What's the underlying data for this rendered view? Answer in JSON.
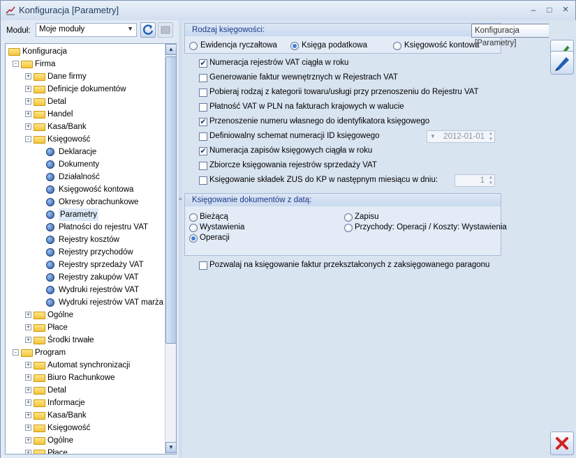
{
  "window": {
    "title": "Konfiguracja [Parametry]",
    "minimize": "–",
    "maximize": "□",
    "close": "×"
  },
  "module": {
    "label": "Moduł:",
    "value": "Moje moduły"
  },
  "tree": {
    "items": [
      {
        "label": "Konfiguracja",
        "level": 0,
        "icon": "folder-open-icon"
      },
      {
        "label": "Firma",
        "level": 1,
        "icon": "folder-open-icon",
        "expander": "-"
      },
      {
        "label": "Dane firmy",
        "level": 2,
        "icon": "folder-icon",
        "expander": "+"
      },
      {
        "label": "Definicje dokumentów",
        "level": 2,
        "icon": "folder-icon",
        "expander": "+"
      },
      {
        "label": "Detal",
        "level": 2,
        "icon": "folder-icon",
        "expander": "+"
      },
      {
        "label": "Handel",
        "level": 2,
        "icon": "folder-icon",
        "expander": "+"
      },
      {
        "label": "Kasa/Bank",
        "level": 2,
        "icon": "folder-icon",
        "expander": "+"
      },
      {
        "label": "Księgowość",
        "level": 2,
        "icon": "folder-open-icon",
        "expander": "-"
      },
      {
        "label": "Deklaracje",
        "level": 3,
        "icon": "leaf-icon"
      },
      {
        "label": "Dokumenty",
        "level": 3,
        "icon": "leaf-icon"
      },
      {
        "label": "Działalność",
        "level": 3,
        "icon": "leaf-icon"
      },
      {
        "label": "Księgowość kontowa",
        "level": 3,
        "icon": "leaf-icon"
      },
      {
        "label": "Okresy obrachunkowe",
        "level": 3,
        "icon": "leaf-icon"
      },
      {
        "label": "Parametry",
        "level": 3,
        "icon": "leaf-icon",
        "selected": true
      },
      {
        "label": "Płatności do rejestru VAT",
        "level": 3,
        "icon": "leaf-icon"
      },
      {
        "label": "Rejestry kosztów",
        "level": 3,
        "icon": "leaf-icon"
      },
      {
        "label": "Rejestry przychodów",
        "level": 3,
        "icon": "leaf-icon"
      },
      {
        "label": "Rejestry sprzedaży VAT",
        "level": 3,
        "icon": "leaf-icon"
      },
      {
        "label": "Rejestry zakupów VAT",
        "level": 3,
        "icon": "leaf-icon"
      },
      {
        "label": "Wydruki rejestrów VAT",
        "level": 3,
        "icon": "leaf-icon"
      },
      {
        "label": "Wydruki rejestrów VAT marża",
        "level": 3,
        "icon": "leaf-icon"
      },
      {
        "label": "Ogólne",
        "level": 2,
        "icon": "folder-icon",
        "expander": "+"
      },
      {
        "label": "Płace",
        "level": 2,
        "icon": "folder-icon",
        "expander": "+"
      },
      {
        "label": "Środki trwałe",
        "level": 2,
        "icon": "folder-icon",
        "expander": "+"
      },
      {
        "label": "Program",
        "level": 1,
        "icon": "folder-open-icon",
        "expander": "-"
      },
      {
        "label": "Automat synchronizacji",
        "level": 2,
        "icon": "folder-icon",
        "expander": "+"
      },
      {
        "label": "Biuro Rachunkowe",
        "level": 2,
        "icon": "folder-icon",
        "expander": "+"
      },
      {
        "label": "Detal",
        "level": 2,
        "icon": "folder-icon",
        "expander": "+"
      },
      {
        "label": "Informacje",
        "level": 2,
        "icon": "folder-icon",
        "expander": "+"
      },
      {
        "label": "Kasa/Bank",
        "level": 2,
        "icon": "folder-icon",
        "expander": "+"
      },
      {
        "label": "Księgowość",
        "level": 2,
        "icon": "folder-icon",
        "expander": "+"
      },
      {
        "label": "Ogólne",
        "level": 2,
        "icon": "folder-icon",
        "expander": "+"
      },
      {
        "label": "Płace",
        "level": 2,
        "icon": "folder-icon",
        "expander": "+"
      }
    ]
  },
  "rodzaj": {
    "title": "Rodzaj księgowości:",
    "options": [
      {
        "label": "Ewidencja ryczałtowa",
        "checked": false
      },
      {
        "label": "Księga podatkowa",
        "checked": true
      },
      {
        "label": "Księgowość kontowa",
        "checked": false
      }
    ]
  },
  "options": [
    {
      "label": "Numeracja rejestrów VAT ciągła w roku",
      "checked": true
    },
    {
      "label": "Generowanie faktur wewnętrznych w Rejestrach VAT",
      "checked": false
    },
    {
      "label": "Pobieraj rodzaj z kategorii towaru/usługi przy przenoszeniu do Rejestru VAT",
      "checked": false
    },
    {
      "label": "Płatność VAT w PLN na fakturach krajowych w walucie",
      "checked": false
    },
    {
      "label": "Przenoszenie numeru własnego do identyfikatora księgowego",
      "checked": true
    },
    {
      "label": "Definiowalny schemat numeracji ID księgowego",
      "checked": false
    },
    {
      "label": "Numeracja zapisów księgowych ciągła w roku",
      "checked": true
    },
    {
      "label": "Zbiorcze księgowania rejestrów sprzedaży VAT",
      "checked": false
    },
    {
      "label": "Księgowanie składek ZUS do KP w następnym miesiącu w dniu:",
      "checked": false
    }
  ],
  "date_field": {
    "value": "2012-01-01"
  },
  "day_field": {
    "value": "1"
  },
  "ksiegowanie": {
    "title": "Księgowanie  dokumentów z datą:",
    "options": [
      {
        "label": "Bieżącą",
        "checked": false
      },
      {
        "label": "Wystawienia",
        "checked": false
      },
      {
        "label": "Operacji",
        "checked": true
      },
      {
        "label": "Zapisu",
        "checked": false
      },
      {
        "label": "Przychody: Operacji / Koszty: Wystawienia",
        "checked": false
      }
    ]
  },
  "paragon_option": {
    "label": "Pozwalaj na księgowanie faktur przekształconych z zaksięgowanego paragonu",
    "checked": false
  },
  "tooltip": {
    "text": "Konfiguracja [Parametry]"
  },
  "colors": {
    "accent": "#3f7fd6",
    "group_title": "#1e3a8a",
    "close_red": "#d42020"
  }
}
